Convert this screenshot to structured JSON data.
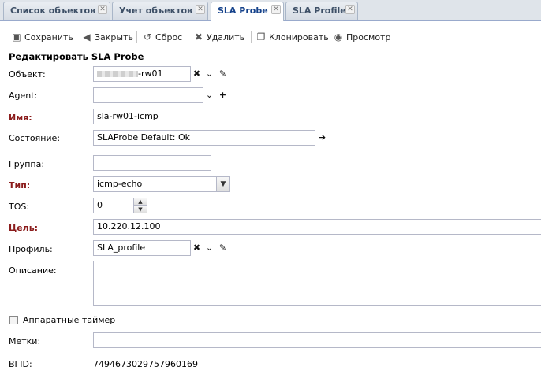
{
  "tabs": [
    {
      "label": "Список объектов"
    },
    {
      "label": "Учет объектов"
    },
    {
      "label": "SLA Probe"
    },
    {
      "label": "SLA Profile"
    }
  ],
  "toolbar": {
    "save": "Сохранить",
    "close": "Закрыть",
    "reset": "Сброс",
    "delete": "Удалить",
    "clone": "Клонировать",
    "view": "Просмотр"
  },
  "form": {
    "title": "Редактировать SLA Probe",
    "object": {
      "label": "Объект:",
      "value": "-rw01"
    },
    "agent": {
      "label": "Agent:",
      "value": ""
    },
    "name": {
      "label": "Имя:",
      "value": "sla-rw01-icmp"
    },
    "state": {
      "label": "Состояние:",
      "value": "SLAProbe Default: Ok"
    },
    "group": {
      "label": "Группа:",
      "value": ""
    },
    "type": {
      "label": "Тип:",
      "value": "icmp-echo"
    },
    "tos": {
      "label": "TOS:",
      "value": "0"
    },
    "target": {
      "label": "Цель:",
      "value": "10.220.12.100"
    },
    "profile": {
      "label": "Профиль:",
      "value": "SLA_profile"
    },
    "description": {
      "label": "Описание:",
      "value": ""
    },
    "hw_timers": {
      "label": "Аппаратные таймер",
      "checked": false
    },
    "labels": {
      "label": "Метки:",
      "value": ""
    },
    "bi_id": {
      "label": "BI ID:",
      "value": "7494673029757960169"
    }
  }
}
